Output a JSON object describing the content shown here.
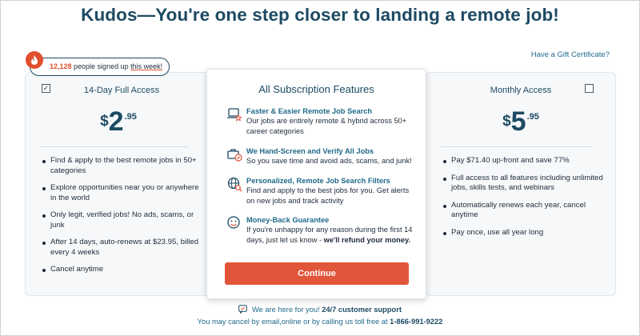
{
  "headline": "Kudos—You're one step closer to landing a remote job!",
  "gift_link": "Have a Gift Certificate?",
  "signup_badge": {
    "count": "12,128",
    "text_mid": " people signed up ",
    "text_end": "this week!",
    "icon": "flame-icon"
  },
  "plans": [
    {
      "title": "14-Day Full Access",
      "checked": true,
      "currency": "$",
      "dollars": "2",
      "cents": ".95",
      "bullets": [
        "Find & apply to the best remote jobs in 50+ categories",
        "Explore opportunities near you or anywhere in the world",
        "Only legit, verified jobs! No ads, scams, or junk",
        "After 14 days, auto-renews at $23.95, billed every 4 weeks",
        "Cancel anytime"
      ]
    },
    {
      "title": "Monthly Access",
      "checked": false,
      "currency": "$",
      "dollars": "5",
      "cents": ".95",
      "bullets": [
        "Pay $71.40 up-front and save 77%",
        "Full access to all features including unlimited jobs, skills tests, and webinars",
        "Automatically renews each year, cancel anytime",
        "Pay once, use all year long"
      ]
    }
  ],
  "features": {
    "title": "All Subscription Features",
    "items": [
      {
        "icon": "laptop-star-icon",
        "title": "Faster & Easier Remote Job Search",
        "desc": "Our jobs are entirely remote & hybrid across 50+ career categories"
      },
      {
        "icon": "briefcase-check-icon",
        "title": "We Hand-Screen and Verify All Jobs",
        "desc": "So you save time and avoid ads, scams, and junk!"
      },
      {
        "icon": "globe-search-icon",
        "title": "Personalized, Remote Job Search Filters",
        "desc": "Find and apply to the best jobs for you. Get alerts on new jobs and track activity"
      },
      {
        "icon": "smiley-icon",
        "title": "Money-Back Guarantee",
        "desc": "If you're unhappy for any reason during the first 14 days, just let us know - ",
        "desc_bold": "we'll refund your money."
      }
    ],
    "continue_label": "Continue"
  },
  "support": {
    "text": "We are here for you! ",
    "bold": "24/7 customer support"
  },
  "cancel_line": {
    "text": "You may cancel by email,online or by calling us toll free at ",
    "phone": "1-866-991-9222"
  },
  "colors": {
    "brand_navy": "#1d4a63",
    "link_blue": "#1f6a8a",
    "accent_orange": "#e1553a"
  }
}
